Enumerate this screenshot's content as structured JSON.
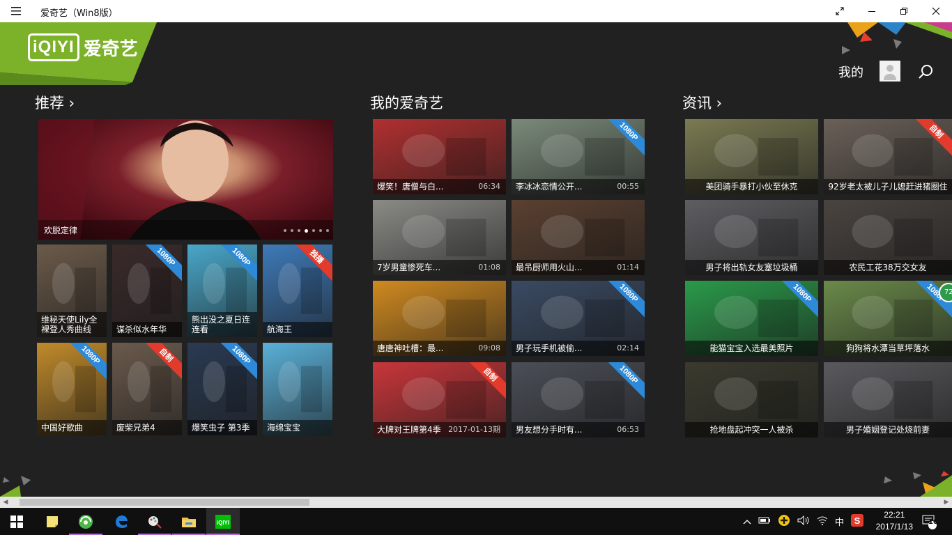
{
  "window": {
    "title": "爱奇艺（Win8版）",
    "menu_icon": "hamburger-icon",
    "fullscreen_icon": "expand-icon",
    "minimize_icon": "minimize-icon",
    "restore_icon": "restore-icon",
    "close_icon": "close-icon"
  },
  "brand": {
    "logo_en": "iQIYI",
    "logo_cn": "爱奇艺",
    "color": "#7cb12a"
  },
  "header": {
    "me_label": "我的",
    "avatar_icon": "person-icon",
    "search_icon": "search-icon"
  },
  "sections": {
    "recommend": {
      "title": "推荐 ›",
      "hero": {
        "caption": "欢脱定律",
        "dots_total": 7,
        "dots_active": 4
      },
      "tiles": [
        {
          "caption": "维秘天使Lily全裸登人秀曲线",
          "badge": "",
          "badge_color": "",
          "bg": "#6b5a4a"
        },
        {
          "caption": "谋杀似水年华",
          "badge": "1080P",
          "badge_color": "blue",
          "bg": "#3a2a2a"
        },
        {
          "caption": "熊出没之夏日连连看",
          "badge": "1080P",
          "badge_color": "blue",
          "bg": "#49a7c9"
        },
        {
          "caption": "航海王",
          "badge": "独播",
          "badge_color": "red",
          "bg": "#3e7ab8"
        },
        {
          "caption": "中国好歌曲",
          "badge": "1080P",
          "badge_color": "blue",
          "bg": "#c08a2a"
        },
        {
          "caption": "废柴兄弟4",
          "badge": "自制",
          "badge_color": "red",
          "bg": "#6b5a4c"
        },
        {
          "caption": "爆笑虫子 第3季",
          "badge": "1080P",
          "badge_color": "blue",
          "bg": "#2a3a52"
        },
        {
          "caption": "海绵宝宝",
          "badge": "",
          "badge_color": "",
          "bg": "#5ab0d8"
        }
      ]
    },
    "mine": {
      "title": "我的爱奇艺",
      "tiles": [
        {
          "caption": "爆笑！唐僧与白...",
          "duration": "06:34",
          "badge": "",
          "badge_color": "",
          "bg": "#b03030"
        },
        {
          "caption": "李冰冰恋情公开...",
          "duration": "00:55",
          "badge": "1080P",
          "badge_color": "blue",
          "bg": "#7a8a7a"
        },
        {
          "caption": "7岁男童惨死车...",
          "duration": "01:08",
          "badge": "",
          "badge_color": "",
          "bg": "#8a8a86"
        },
        {
          "caption": "最吊厨师用火山...",
          "duration": "01:14",
          "badge": "",
          "badge_color": "",
          "bg": "#5a4030"
        },
        {
          "caption": "唐唐神吐槽：最...",
          "duration": "09:08",
          "badge": "",
          "badge_color": "",
          "bg": "#d08a20"
        },
        {
          "caption": "男子玩手机被偷...",
          "duration": "02:14",
          "badge": "1080P",
          "badge_color": "blue",
          "bg": "#3a4a62"
        },
        {
          "caption": "大牌对王牌第4季",
          "duration": "2017-01-13期",
          "badge": "自制",
          "badge_color": "red",
          "bg": "#c8363a"
        },
        {
          "caption": "男友想分手时有...",
          "duration": "06:53",
          "badge": "1080P",
          "badge_color": "blue",
          "bg": "#4a4e56"
        }
      ]
    },
    "news": {
      "title": "资讯 ›",
      "tiles": [
        {
          "caption": "美团骑手暴打小伙至休克",
          "badge": "",
          "badge_color": "",
          "bg": "#7a7a52"
        },
        {
          "caption": "92岁老太被儿子儿媳赶进猪圈住",
          "badge": "自制",
          "badge_color": "red",
          "bg": "#6a6058"
        },
        {
          "caption": "男子将出轨女友塞垃圾桶",
          "badge": "",
          "badge_color": "",
          "bg": "#5e5e62"
        },
        {
          "caption": "农民工花38万交女友",
          "badge": "",
          "badge_color": "",
          "bg": "#4a4440"
        },
        {
          "caption": "能猫宝宝入选最美照片",
          "badge": "1080P",
          "badge_color": "blue",
          "bg": "#2a9a4a"
        },
        {
          "caption": "狗狗将水潭当草坪落水",
          "badge": "1080P",
          "badge_color": "blue",
          "bg": "#6a8a4a"
        },
        {
          "caption": "抢地盘起冲突一人被杀",
          "badge": "",
          "badge_color": "",
          "bg": "#3a3a2e"
        },
        {
          "caption": "男子婚姻登记处烧前妻",
          "badge": "",
          "badge_color": "",
          "bg": "#5a5a5e"
        }
      ],
      "extra_badge": "72"
    }
  },
  "taskbar": {
    "start_icon": "windows-start-icon",
    "apps": [
      "sticky-notes-icon",
      "browser-360-icon",
      "edge-icon",
      "paint-icon",
      "file-explorer-icon",
      "iqiyi-app-icon"
    ],
    "tray_icons": [
      "chevron-up-icon",
      "battery-icon",
      "network-plus-icon",
      "volume-icon",
      "wifi-icon"
    ],
    "ime": "中",
    "sogou_icon": "sogou-icon",
    "time": "22:21",
    "date": "2017/1/13",
    "notification_count": "10",
    "action_center_icon": "action-center-icon"
  }
}
